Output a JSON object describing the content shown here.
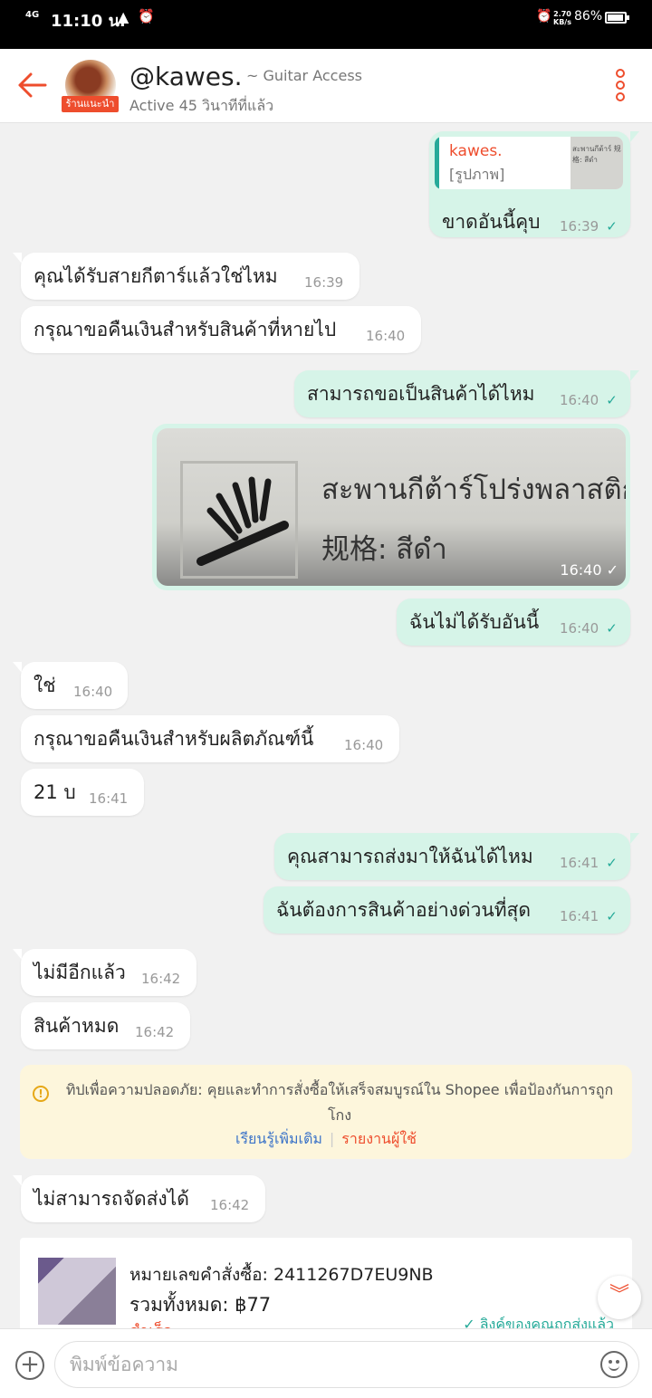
{
  "status_bar": {
    "network": "4G",
    "time": "11:10 น.",
    "speed_value": "2.70",
    "speed_unit": "KB/s",
    "battery": "86%"
  },
  "header": {
    "shop_name": "@kawes.",
    "shop_subtitle": "~ Guitar Access",
    "badge": "ร้านแนะนำ",
    "active_status": "Active 45 วินาทีที่แล้ว",
    "back_icon": "arrow-left-icon",
    "more_icon": "more-vertical-icon"
  },
  "messages": [
    {
      "dir": "out",
      "quote_name": "kawes.",
      "quote_text": "[รูปภาพ]",
      "quote_thumb_text": "สะพานกีต้าร์ 规格: สีดำ",
      "text": "ขาดอันนี้คุบ",
      "time": "16:39"
    },
    {
      "dir": "in",
      "text": "คุณได้รับสายกีตาร์แล้วใช่ไหม",
      "time": "16:39"
    },
    {
      "dir": "in",
      "text": "กรุณาขอคืนเงินสำหรับสินค้าที่หายไป",
      "time": "16:40"
    },
    {
      "dir": "out",
      "text": "สามารถขอเป็นสินค้าได้ไหม",
      "time": "16:40"
    },
    {
      "dir": "out",
      "image": true,
      "caption_line1": "สะพานกีต้าร์โปร่งพลาสติก",
      "caption_line2": "规格: สีดำ",
      "time": "16:40"
    },
    {
      "dir": "out",
      "text": "ฉันไม่ได้รับอันนี้",
      "time": "16:40"
    },
    {
      "dir": "in",
      "text": "ใช่",
      "time": "16:40"
    },
    {
      "dir": "in",
      "text": "กรุณาขอคืนเงินสำหรับผลิตภัณฑ์นี้",
      "time": "16:40"
    },
    {
      "dir": "in",
      "text": "21 บ",
      "time": "16:41"
    },
    {
      "dir": "out",
      "text": "คุณสามารถส่งมาให้ฉันได้ไหม",
      "time": "16:41"
    },
    {
      "dir": "out",
      "text": "ฉันต้องการสินค้าอย่างด่วนที่สุด",
      "time": "16:41"
    },
    {
      "dir": "in",
      "text": "ไม่มีอีกแล้ว",
      "time": "16:42"
    },
    {
      "dir": "in",
      "text": "สินค้าหมด",
      "time": "16:42"
    },
    {
      "dir": "in",
      "text": "ไม่สามารถจัดส่งได้",
      "time": "16:42"
    }
  ],
  "safety_tip": {
    "text": "ทิปเพื่อความปลอดภัย: คุยและทำการสั่งซื้อให้เสร็จสมบูรณ์ใน Shopee เพื่อป้องกันการถูกโกง",
    "learn_more": "เรียนรู้เพิ่มเติม",
    "report": "รายงานผู้ใช้"
  },
  "order_card": {
    "order_number_label": "หมายเลขคำสั่งซื้อ: 2411267D7EU9NB",
    "total_label": "รวมทั้งหมด: ฿77",
    "status": "สำเร็จ",
    "link_sent": "ลิงค์ของคุณถูกส่งแล้ว"
  },
  "input": {
    "placeholder": "พิมพ์ข้อความ"
  },
  "colors": {
    "accent": "#ee4d2d",
    "outgoing_bubble": "#d6f4e8",
    "read_tick": "#26aa99",
    "tip_background": "#fdf6dc"
  }
}
